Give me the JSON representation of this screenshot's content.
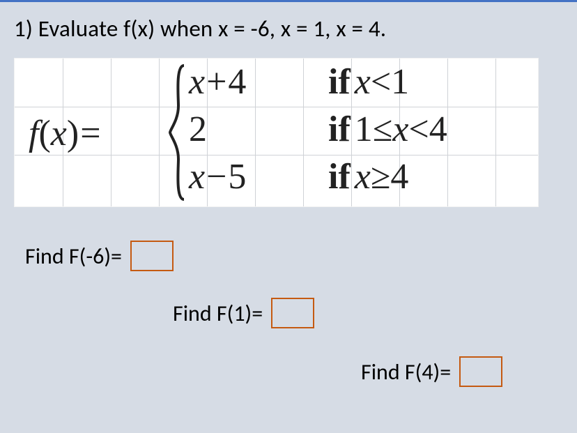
{
  "question": "1) Evaluate f(x) when x = -6, x = 1, x = 4.",
  "function": {
    "lhs": "f(x)=",
    "pieces": [
      {
        "expr": "x+4",
        "cond_kw": "if",
        "cond": "x<1"
      },
      {
        "expr": "2",
        "cond_kw": "if",
        "cond": "1≤x<4"
      },
      {
        "expr": "x−5",
        "cond_kw": "if",
        "cond": "x≥4"
      }
    ]
  },
  "answers": [
    {
      "label": "Find F(-6)="
    },
    {
      "label": "Find F(1)="
    },
    {
      "label": "Find F(4)="
    }
  ]
}
